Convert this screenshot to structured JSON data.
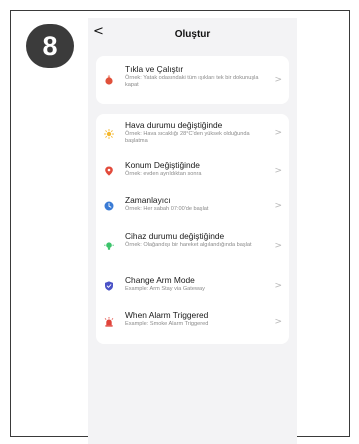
{
  "step": "8",
  "header": {
    "back_glyph": "<",
    "title": "Oluştur"
  },
  "tap_card": {
    "title": "Tıkla ve Çalıştır",
    "subtitle": "Örnek: Yatak odasındaki tüm ışıkları tek bir dokunuşla kapat",
    "icon": "tap-hand-icon",
    "color": "#e0503a"
  },
  "conditions": [
    {
      "id": "weather",
      "title": "Hava durumu değiştiğinde",
      "subtitle": "Örnek: Hava sıcaklığı 28°C'den yüksek olduğunda başlatma",
      "icon": "sun-icon",
      "color": "#f5b82e"
    },
    {
      "id": "location",
      "title": "Konum Değiştiğinde",
      "subtitle": "Örnek: evden ayrıldıktan sonra",
      "icon": "location-pin-icon",
      "color": "#e24a3b"
    },
    {
      "id": "timer",
      "title": "Zamanlayıcı",
      "subtitle": "Örnek: Her sabah 07:00'de başlat",
      "icon": "clock-icon",
      "color": "#3a7bd5"
    },
    {
      "id": "device",
      "title": "Cihaz durumu değiştiğinde",
      "subtitle": "Örnek: Olağandışı bir hareket algılandığında başlat",
      "icon": "device-bulb-icon",
      "color": "#3cc36b"
    },
    {
      "id": "arm-mode",
      "title": "Change Arm Mode",
      "subtitle": "Example: Arm Stay via Gateway",
      "icon": "shield-icon",
      "color": "#4a52c6"
    },
    {
      "id": "alarm",
      "title": "When Alarm Triggered",
      "subtitle": "Example: Smoke Alarm Triggered",
      "icon": "alarm-siren-icon",
      "color": "#e0433a"
    }
  ],
  "chevron_glyph": ">"
}
